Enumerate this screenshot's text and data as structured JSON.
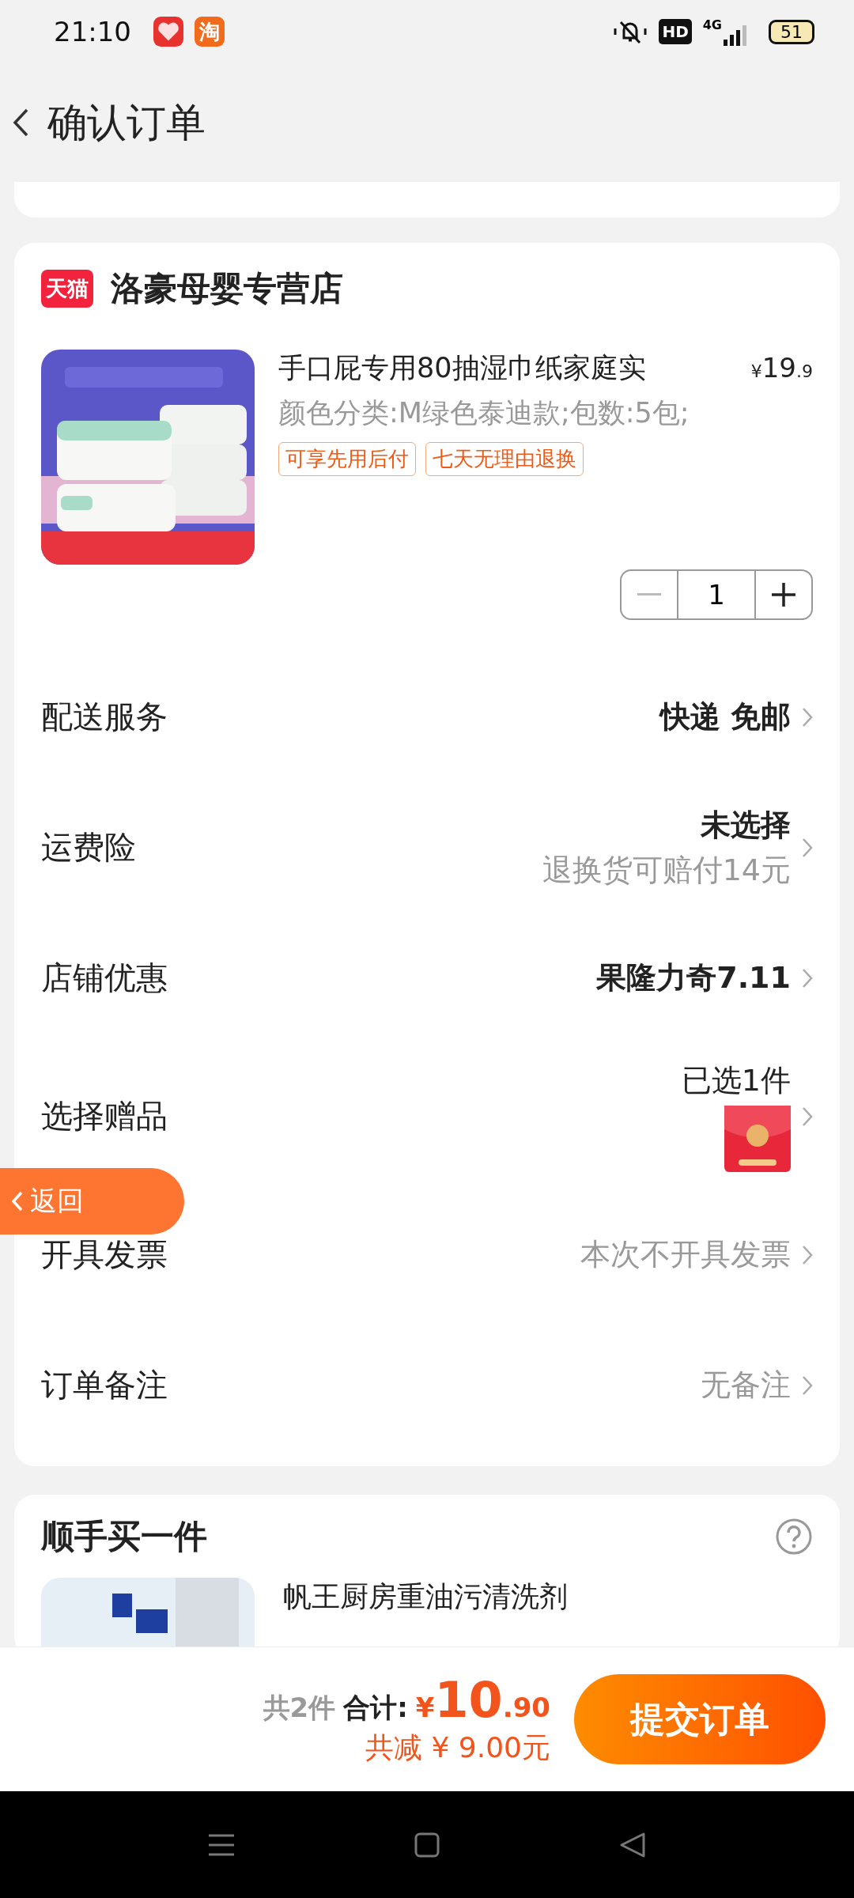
{
  "status_bar": {
    "time": "21:10",
    "app_glyph": "淘",
    "hd": "HD",
    "network": "4G",
    "battery": "51"
  },
  "header": {
    "title": "确认订单"
  },
  "store": {
    "badge": "天猫",
    "name": "洛豪母婴专营店"
  },
  "product": {
    "title": "手口屁专用80抽湿巾纸家庭实",
    "currency": "¥",
    "price_int": "19",
    "price_dec": ".9",
    "spec": "颜色分类:M绿色泰迪款;包数:5包;",
    "tags": [
      "可享先用后付",
      "七天无理由退换"
    ],
    "quantity": "1"
  },
  "options": [
    {
      "label": "配送服务",
      "value": "快递 免邮",
      "kind": "bold"
    },
    {
      "label": "运费险",
      "value": "未选择",
      "note": "退换货可赔付14元",
      "kind": "bold"
    },
    {
      "label": "店铺优惠",
      "value": "果隆力奇7.11",
      "kind": "bold"
    },
    {
      "label": "选择赠品",
      "value": "已选1件",
      "kind": "gift"
    },
    {
      "label": "开具发票",
      "value": "本次不开具发票",
      "kind": "muted"
    },
    {
      "label": "订单备注",
      "value": "无备注",
      "kind": "muted"
    }
  ],
  "recommend": {
    "title": "顺手买一件",
    "product_title": "帆王厨房重油污清洗剂"
  },
  "back_button": "返回",
  "checkout": {
    "count": "共2件",
    "total_label": "合计:",
    "currency": "¥",
    "total_int": "10",
    "total_dec": ".90",
    "discount": "共减 ¥ 9.00元",
    "submit": "提交订单"
  }
}
